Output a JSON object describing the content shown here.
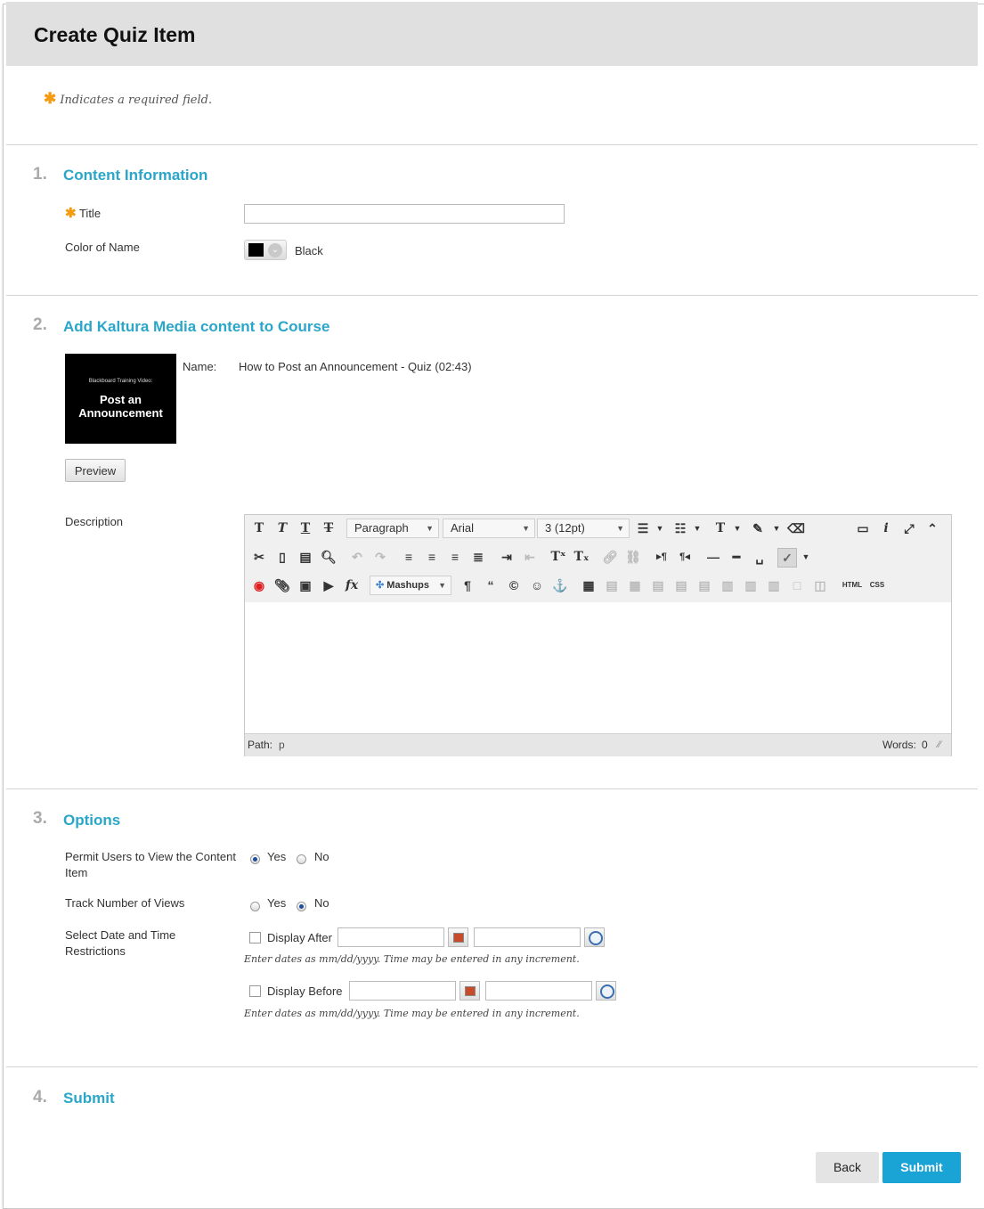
{
  "page": {
    "title": "Create Quiz Item",
    "required_note": "Indicates a required field."
  },
  "sections": {
    "s1": {
      "number": "1.",
      "title": "Content Information"
    },
    "s2": {
      "number": "2.",
      "title": "Add Kaltura Media content to Course"
    },
    "s3": {
      "number": "3.",
      "title": "Options"
    },
    "s4": {
      "number": "4.",
      "title": "Submit"
    }
  },
  "content_info": {
    "title_label": "Title",
    "title_value": "",
    "color_label": "Color of Name",
    "color_value": "Black",
    "color_hex": "#000000"
  },
  "media": {
    "name_label": "Name:",
    "name_value": "How to Post an Announcement - Quiz (02:43)",
    "thumb_small": "Blackboard Training Video:",
    "thumb_big_1": "Post an",
    "thumb_big_2": "Announcement",
    "preview_button": "Preview"
  },
  "description": {
    "label": "Description",
    "paragraph_select": "Paragraph",
    "font_select": "Arial",
    "size_select": "3 (12pt)",
    "mashups_label": "Mashups",
    "html_label": "HTML",
    "css_label": "CSS",
    "path_label": "Path:",
    "path_value": "p",
    "words_label": "Words:",
    "words_value": "0"
  },
  "options": {
    "permit_label": "Permit Users to View the Content Item",
    "permit_selected": "Yes",
    "track_label": "Track Number of Views",
    "track_selected": "No",
    "yes_label": "Yes",
    "no_label": "No",
    "date_label": "Select Date and Time Restrictions",
    "display_after_label": "Display After",
    "display_before_label": "Display Before",
    "hint": "Enter dates as mm/dd/yyyy. Time may be entered in any increment."
  },
  "footer": {
    "back_label": "Back",
    "submit_label": "Submit"
  },
  "colors": {
    "accent": "#2aa6c9",
    "submit": "#1aa4d6",
    "required": "#f39c12"
  }
}
